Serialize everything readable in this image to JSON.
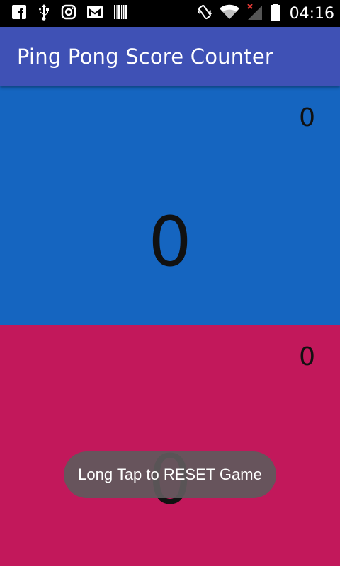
{
  "status_bar": {
    "time": "04:16",
    "left_icons": [
      "facebook-icon",
      "usb-icon",
      "instagram-icon",
      "gmail-icon",
      "barcode-icon"
    ],
    "right_icons": [
      "vibrate-icon",
      "wifi-icon",
      "signal-icon",
      "battery-icon"
    ]
  },
  "app_bar": {
    "title": "Ping Pong Score Counter",
    "color": "#3F51B5"
  },
  "player_one": {
    "color": "#1565C0",
    "sets_score": "0",
    "points_score": "0"
  },
  "player_two": {
    "color": "#C2185B",
    "sets_score": "0",
    "points_score": "0"
  },
  "toast": {
    "message": "Long Tap to RESET Game"
  }
}
